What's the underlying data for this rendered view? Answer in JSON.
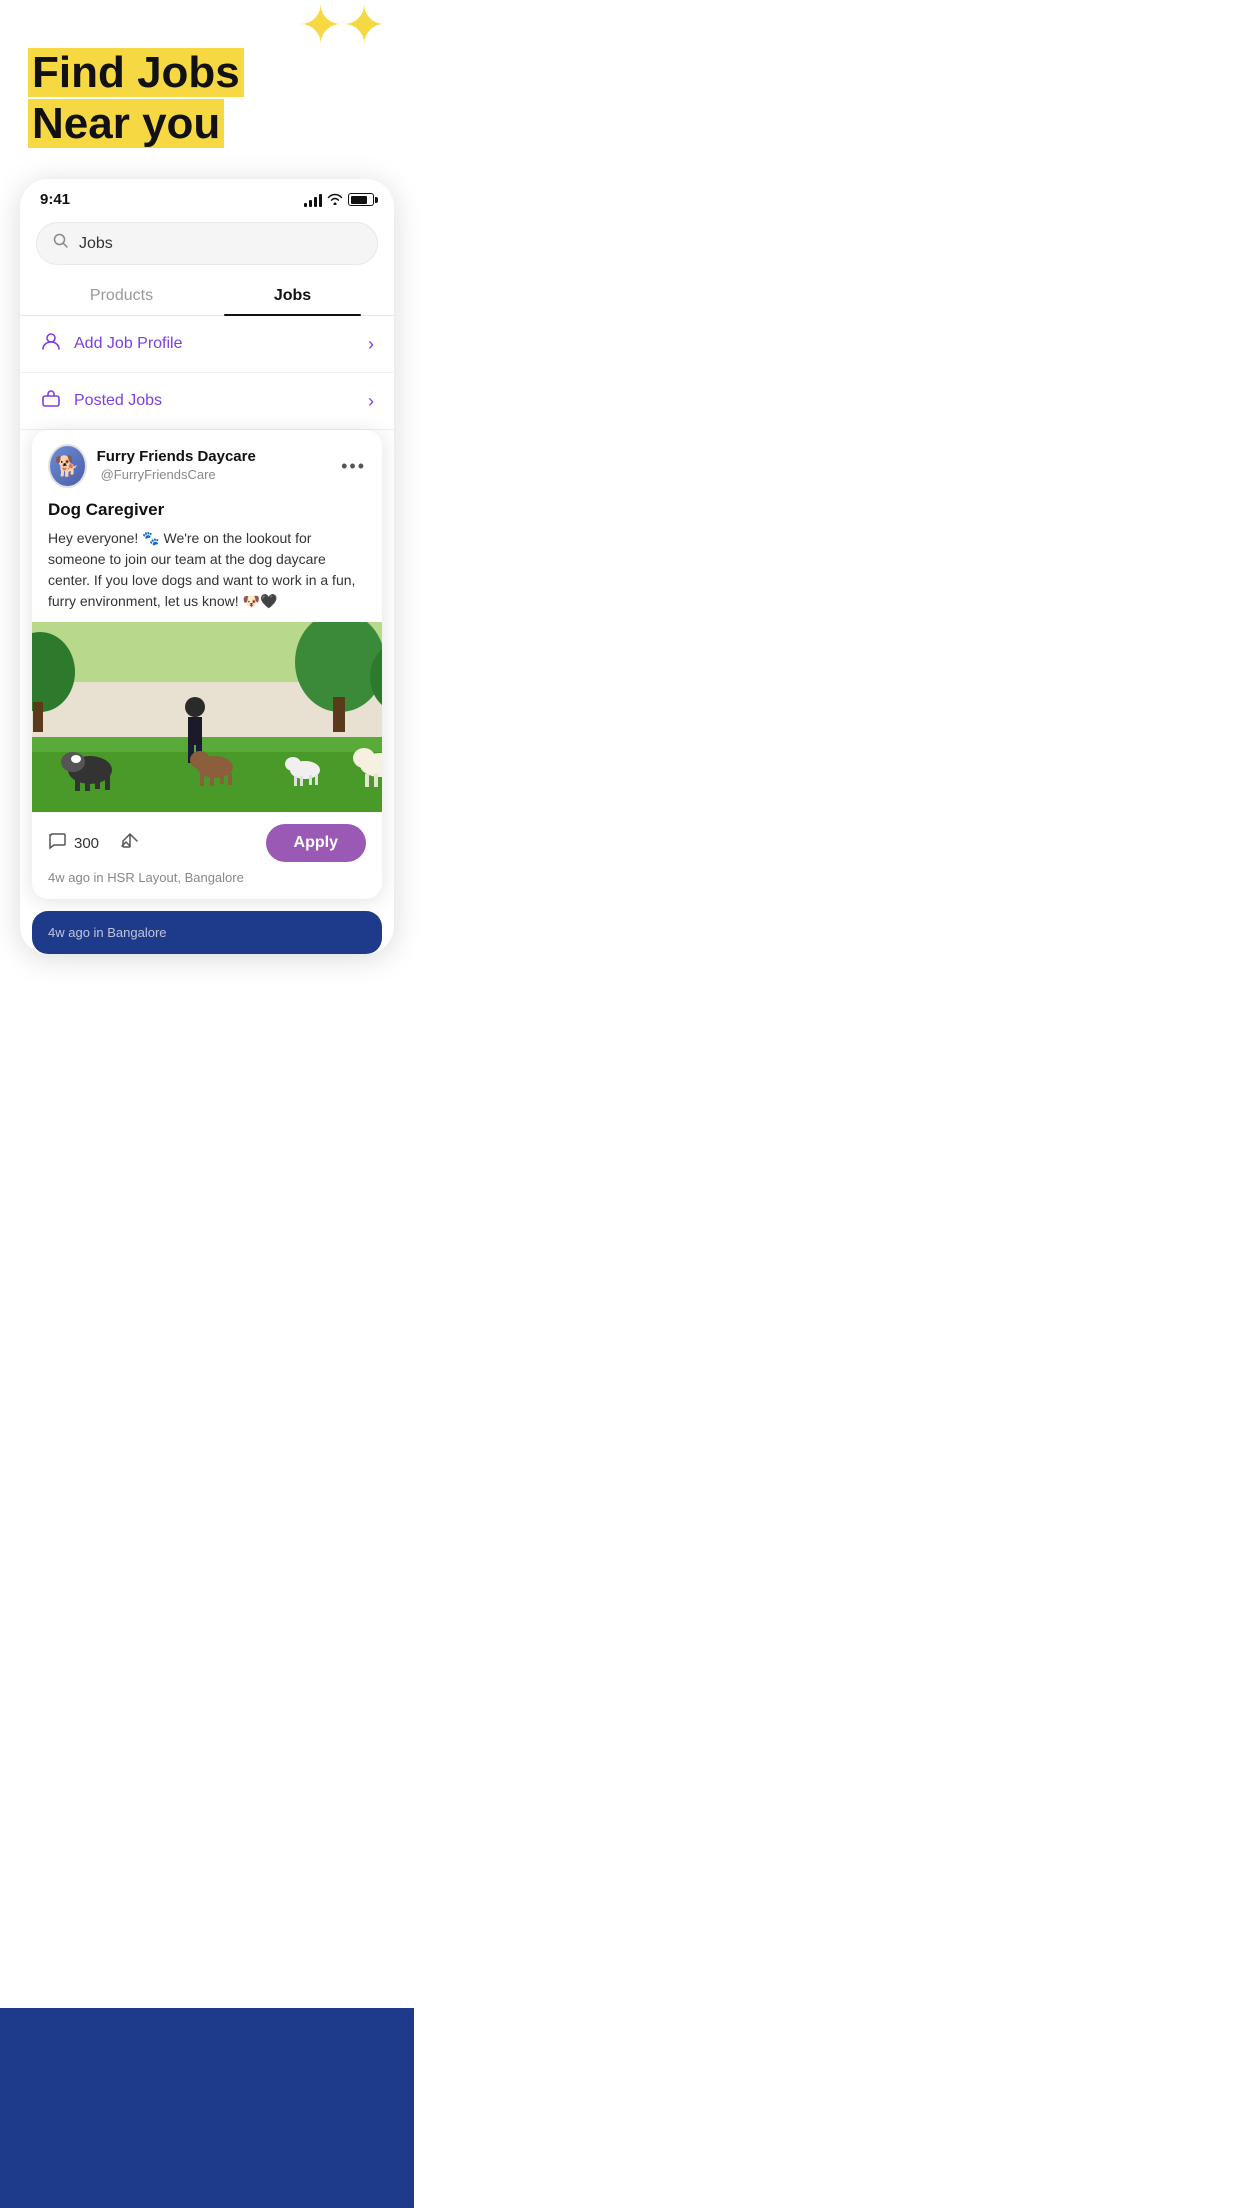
{
  "page": {
    "title": "Find Jobs Near you"
  },
  "header": {
    "title_line1": "Find Jobs",
    "title_line2": "Near you"
  },
  "status_bar": {
    "time": "9:41"
  },
  "search": {
    "placeholder": "Jobs",
    "value": "Jobs"
  },
  "tabs": [
    {
      "label": "Products",
      "active": false
    },
    {
      "label": "Jobs",
      "active": true
    }
  ],
  "menu_items": [
    {
      "icon": "👤",
      "label": "Add Job Profile",
      "chevron": "›"
    },
    {
      "icon": "💼",
      "label": "Posted Jobs",
      "chevron": "›"
    }
  ],
  "post": {
    "account_name": "Furry Friends Daycare",
    "account_handle": "@FurryFriendsCare",
    "job_title": "Dog Caregiver",
    "body": "Hey everyone! 🐾 We're on the lookout for someone to join our team at the dog daycare center. If you love dogs and want to work in a fun, furry environment, let us know! 🐶🖤",
    "comment_count": "300",
    "time_ago": "4w ago in HSR Layout, Bangalore",
    "apply_label": "Apply"
  },
  "second_post": {
    "time_ago": "4w ago in Bangalore"
  },
  "colors": {
    "accent_purple": "#9B59B6",
    "accent_yellow": "#F5D842",
    "navy_blue": "#1E3A8A",
    "menu_purple": "#7B3FE4"
  }
}
